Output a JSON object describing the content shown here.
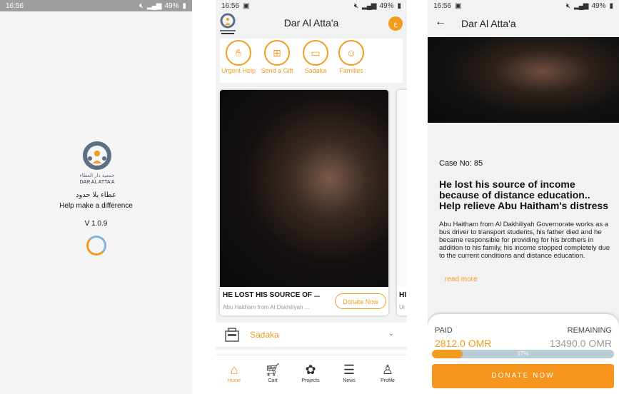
{
  "status": {
    "time": "16:56",
    "battery": "49%"
  },
  "splash": {
    "logo_text": "DAR AL ATTA'A",
    "logo_text_ar": "جمعية دار العطاء",
    "tagline_ar": "عطاء بلا حدود",
    "tagline_en": "Help make a difference",
    "version": "V 1.0.9"
  },
  "home": {
    "title": "Dar Al Atta'a",
    "avatar_letter": "ع",
    "quick_actions": [
      {
        "label": "Urgent Help",
        "icon": "hand-money-icon"
      },
      {
        "label": "Send a Gift",
        "icon": "gift-icon"
      },
      {
        "label": "Sadaka",
        "icon": "donate-box-icon"
      },
      {
        "label": "Families",
        "icon": "family-icon"
      }
    ],
    "card": {
      "title": "HE LOST HIS SOURCE OF ...",
      "subtitle": "Abu Haitham from Al Dakhiliyah ...",
      "button": "Donate Now"
    },
    "card2": {
      "title": "HI",
      "subtitle": "Ur"
    },
    "section": {
      "label": "Sadaka"
    },
    "nav": [
      {
        "label": "Home",
        "icon": "home-icon"
      },
      {
        "label": "Cart",
        "icon": "cart-icon"
      },
      {
        "label": "Projects",
        "icon": "projects-icon"
      },
      {
        "label": "News",
        "icon": "news-icon"
      },
      {
        "label": "Profile",
        "icon": "profile-icon"
      }
    ]
  },
  "detail": {
    "title": "Dar Al Atta'a",
    "case_label": "Case No:",
    "case_no": "85",
    "headline": "He lost his source of income because of distance education.. Help relieve Abu Haitham's distress",
    "description": "Abu Haitham from Al Dakhiliyah Governorate works as a bus driver to transport students, his father died and he became responsible for providing for his brothers in addition to his family, his income stopped completely due to the current conditions and distance education.",
    "read_more": "read more",
    "paid_label": "PAID",
    "remaining_label": "REMAINING",
    "paid_value": "2812.0 OMR",
    "remaining_value": "13490.0 OMR",
    "progress_percent": 17,
    "progress_label": "17%",
    "donate_label": "DONATE NOW"
  },
  "colors": {
    "accent": "#f29c1f",
    "progress_track": "#b8cbd6"
  }
}
